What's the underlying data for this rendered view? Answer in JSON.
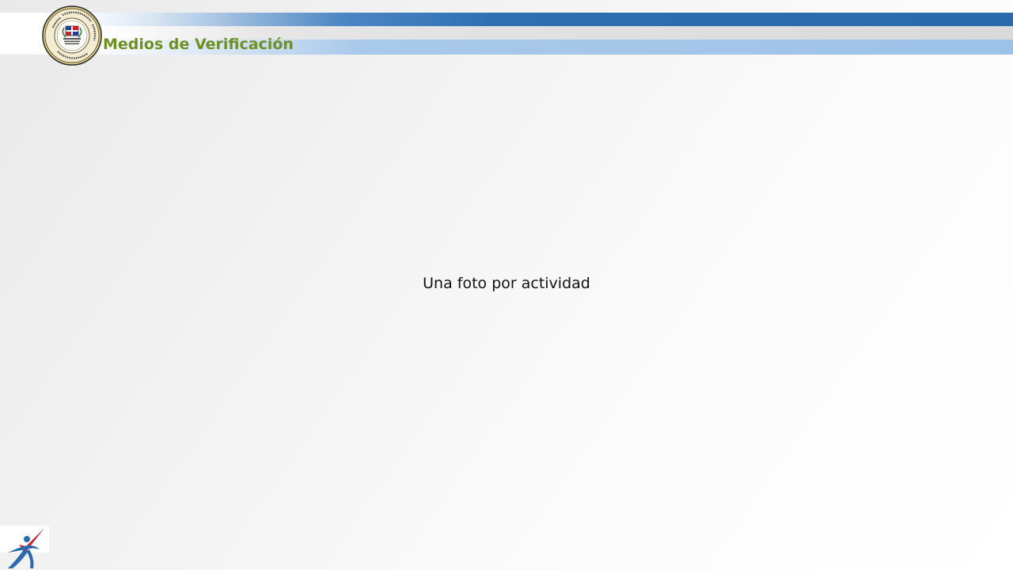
{
  "header": {
    "title": "Medios de Verificación",
    "title_color": "#6f8f23",
    "band_colors": {
      "top": "#2a6aad",
      "middle": "#d9d9d9",
      "bottom": "#9dc2e8"
    }
  },
  "seal": {
    "icon": "institution-seal-icon",
    "ring_text": "PROCURADURIA GENERAL DE LA REPUBLICA",
    "ring_text_bottom": "REPUBLICA DOMINICANA",
    "center_text": "MODELO DE GESTION PENITENCIARIA"
  },
  "content": {
    "text": "Una foto por actividad"
  },
  "footer": {
    "icon": "runner-checkmark-logo-icon",
    "colors": {
      "check": "#d2232a",
      "figure": "#2a6aad"
    }
  }
}
